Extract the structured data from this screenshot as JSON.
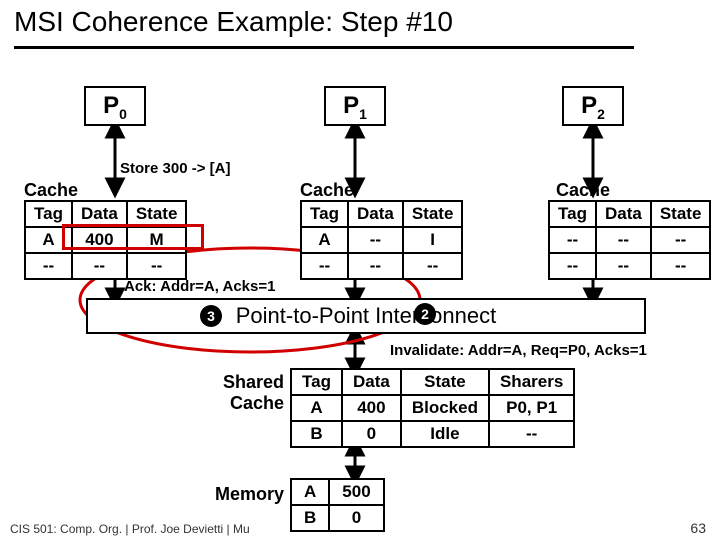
{
  "title": "MSI Coherence Example: Step #10",
  "procs": [
    "P0",
    "P1",
    "P2"
  ],
  "store_label": "Store 300 -> [A]",
  "cache_label": "Cache",
  "cache_headers": [
    "Tag",
    "Data",
    "State"
  ],
  "caches": {
    "p0": [
      [
        "A",
        "400",
        "M"
      ],
      [
        "--",
        "--",
        "--"
      ]
    ],
    "p1": [
      [
        "A",
        "--",
        "I"
      ],
      [
        "--",
        "--",
        "--"
      ]
    ],
    "p2": [
      [
        "--",
        "--",
        "--"
      ],
      [
        "--",
        "--",
        "--"
      ]
    ]
  },
  "ack_label": "Ack: Addr=A, Acks=1",
  "interconnect": "Point-to-Point Interconnect",
  "invalidate_label": "Invalidate: Addr=A, Req=P0, Acks=1",
  "shared_label_l1": "Shared",
  "shared_label_l2": "Cache",
  "shared_headers": [
    "Tag",
    "Data",
    "State",
    "Sharers"
  ],
  "shared_rows": [
    [
      "A",
      "400",
      "Blocked",
      "P0, P1"
    ],
    [
      "B",
      "0",
      "Idle",
      "--"
    ]
  ],
  "memory_label": "Memory",
  "memory_rows": [
    [
      "A",
      "500"
    ],
    [
      "B",
      "0"
    ]
  ],
  "circles": {
    "c2": "2",
    "c3": "3"
  },
  "footer": "CIS 501: Comp. Org.  |  Prof. Joe Devietti  |  Mu",
  "pagenum": "63"
}
